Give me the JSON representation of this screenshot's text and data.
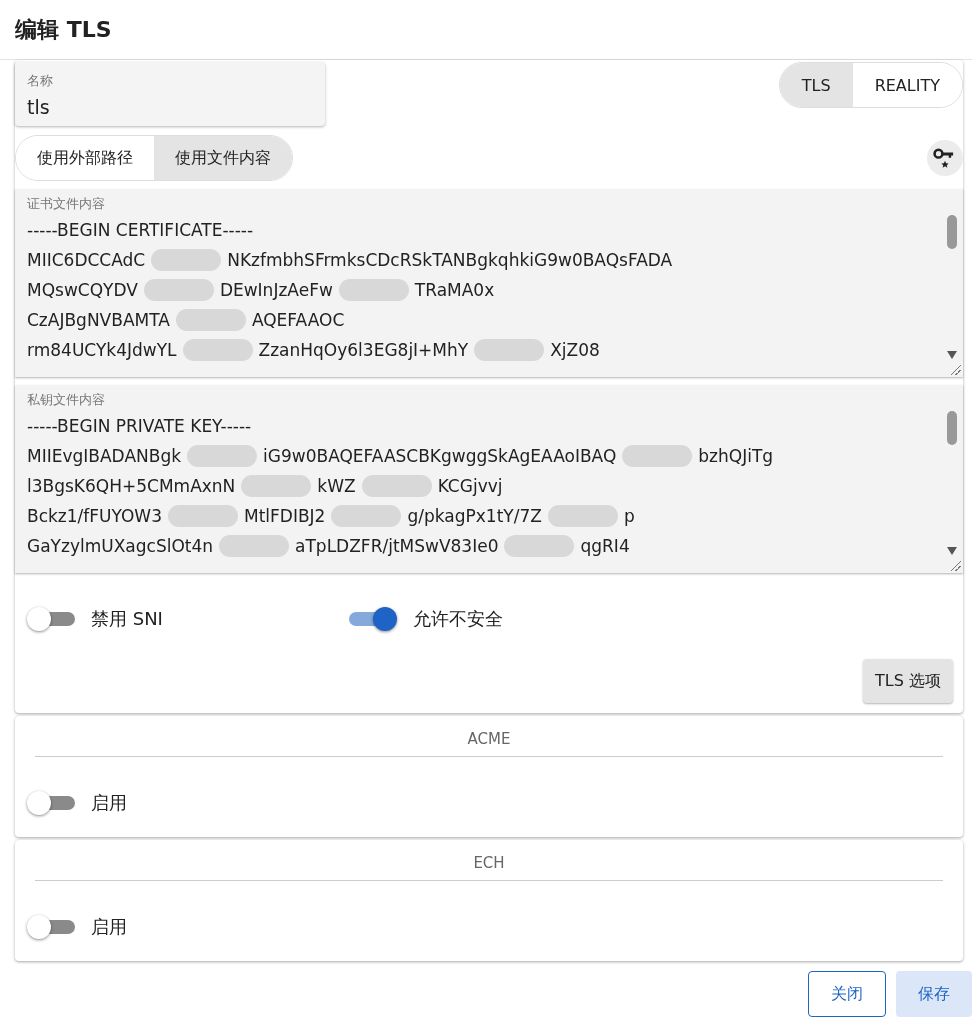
{
  "dialog": {
    "title": "编辑 TLS"
  },
  "name_field": {
    "label": "名称",
    "value": "tls"
  },
  "mode_tabs": [
    {
      "label": "TLS",
      "selected": true
    },
    {
      "label": "REALITY",
      "selected": false
    }
  ],
  "source_tabs": [
    {
      "label": "使用外部路径",
      "selected": false
    },
    {
      "label": "使用文件内容",
      "selected": true
    }
  ],
  "text_areas": [
    {
      "label": "证书文件内容",
      "lines": [
        [
          "-----BEGIN CERTIFICATE-----"
        ],
        [
          "MIIC6DCCAdC",
          "NKzfmbhSFrmksCDcRSkTANBgkqhkiG9w0BAQsFADA"
        ],
        [
          "MQswCQYDV",
          "DEwInJzAeFw",
          "TRaMA0x"
        ],
        [
          "CzAJBgNVBAMTA",
          "AQEFAAOC"
        ],
        [
          "rm84UCYk4JdwYL",
          "ZzanHqOy6l3EG8jI+MhY",
          "XjZ08"
        ]
      ]
    },
    {
      "label": "私钥文件内容",
      "lines": [
        [
          "-----BEGIN PRIVATE KEY-----"
        ],
        [
          "MIIEvgIBADANBgk",
          "iG9w0BAQEFAASCBKgwggSkAgEAAoIBAQ",
          "bzhQJiTg"
        ],
        [
          "l3BgsK6QH+5CMmAxnN",
          "kWZ",
          "KCGjvvj"
        ],
        [
          "Bckz1/fFUYOW3",
          "MtlFDIBJ2",
          "g/pkagPx1tY/7Z",
          "p"
        ],
        [
          "GaYzylmUXagcSlOt4n",
          "aTpLDZFR/jtMSwV83Ie0",
          "qgRI4"
        ]
      ]
    }
  ],
  "switches": [
    {
      "label": "禁用 SNI",
      "on": false
    },
    {
      "label": "允许不安全",
      "on": true
    }
  ],
  "options_button": "TLS 选项",
  "sections": [
    {
      "title": "ACME",
      "switch": {
        "label": "启用",
        "on": false
      }
    },
    {
      "title": "ECH",
      "switch": {
        "label": "启用",
        "on": false
      }
    }
  ],
  "buttons": [
    {
      "label": "关闭",
      "kind": "outlined"
    },
    {
      "label": "保存",
      "kind": "filled"
    }
  ]
}
